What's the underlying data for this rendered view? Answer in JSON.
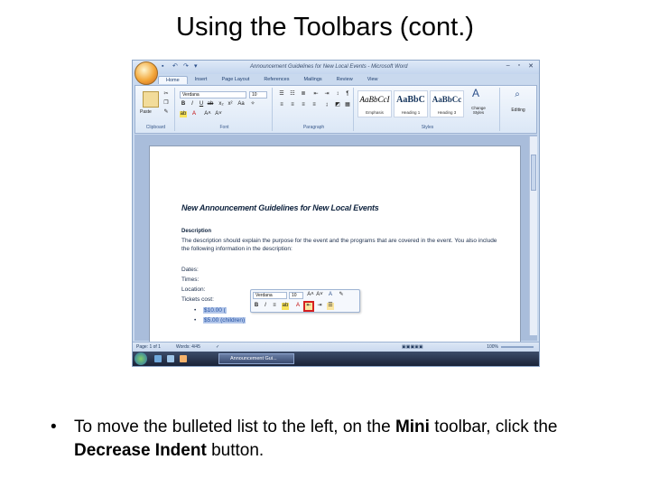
{
  "slide": {
    "title": "Using the Toolbars (cont.)",
    "caption": {
      "bullet": "•",
      "part1": "To move the bulleted list to the left, on the ",
      "bold1": "Mini",
      "part2": " toolbar, click the ",
      "bold2": "Decrease Indent",
      "part3": " button."
    }
  },
  "window": {
    "title": "Announcement Guidelines for New Local Events - Microsoft Word",
    "controls": [
      "–",
      "▫",
      "✕"
    ],
    "qat": [
      "▪",
      "↶",
      "↷",
      "▾"
    ]
  },
  "ribbon": {
    "tabs": [
      "Home",
      "Insert",
      "Page Layout",
      "References",
      "Mailings",
      "Review",
      "View"
    ],
    "active_tab": "Home",
    "clipboard": {
      "label": "Clipboard",
      "paste": "Paste"
    },
    "font": {
      "label": "Font",
      "font_name": "Verdana",
      "font_size": "10"
    },
    "paragraph": {
      "label": "Paragraph"
    },
    "styles": {
      "label": "Styles",
      "items": [
        {
          "sample": "AaBbCcI",
          "name": "Emphasis"
        },
        {
          "sample": "AaBbC",
          "name": "Heading 1"
        },
        {
          "sample": "AaBbCc",
          "name": "Heading 3"
        }
      ],
      "change_styles": "Change Styles"
    },
    "editing": {
      "label": "Editing"
    }
  },
  "document": {
    "heading": "New Announcement Guidelines for New Local Events",
    "sub": "Description",
    "para": "The description should explain the purpose for the event and the programs that are covered in the event. You also include the following information in the description:",
    "lines": [
      "Dates:",
      "Times:",
      "Location:",
      "Tickets cost:"
    ],
    "bullets": [
      "$10.00 (",
      "$5.00 (children)"
    ]
  },
  "mini_toolbar": {
    "font_name": "Verdana",
    "font_size": "10"
  },
  "status": {
    "page": "Page: 1 of 1",
    "words": "Words: 4/45",
    "zoom": "100%"
  },
  "taskbar": {
    "window_button": "Announcement Gui..."
  }
}
